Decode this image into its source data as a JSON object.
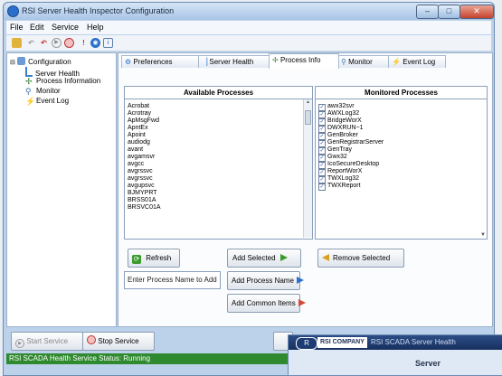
{
  "window": {
    "title": "RSI Server Health Inspector Configuration",
    "controls": {
      "minimize": "–",
      "maximize": "□",
      "close": "✕"
    }
  },
  "menu": [
    "File",
    "Edit",
    "Service",
    "Help"
  ],
  "toolbar_icons": [
    "run-icon",
    "undo-icon",
    "back-icon",
    "play-icon",
    "stop-icon",
    "info-icon",
    "service-icon",
    "about-icon"
  ],
  "tree": {
    "root": "Configuration",
    "children": [
      "Server Health",
      "Process Information",
      "Monitor",
      "Event Log"
    ]
  },
  "tabs": [
    "Preferences",
    "Server Health",
    "Process Info",
    "Monitor",
    "Event Log"
  ],
  "active_tab": "Process Info",
  "available": {
    "header": "Available Processes",
    "items": [
      "Acrobat",
      "Acrotray",
      "ApMsgFwd",
      "ApntEx",
      "Apoint",
      "audiodg",
      "avant",
      "avgamsvr",
      "avgcc",
      "avgrssvc",
      "avgrssvc",
      "avgupsvc",
      "BJMYPRT",
      "BRSS01A",
      "BRSVC01A"
    ]
  },
  "monitored": {
    "header": "Monitored Processes",
    "items": [
      "awx32svr",
      "AWXLog32",
      "BridgeWorX",
      "DWXRUN~1",
      "GenBroker",
      "GenRegistrarServer",
      "GenTray",
      "Gwx32",
      "IcoSecureDesktop",
      "ReportWorX",
      "TWXLog32",
      "TWXReport"
    ]
  },
  "buttons": {
    "refresh": "Refresh",
    "add_selected": "Add Selected",
    "remove_selected": "Remove Selected",
    "add_process_name": "Add Process Name",
    "add_common_items": "Add Common Items",
    "start_service": "Start Service",
    "stop_service": "Stop Service"
  },
  "process_input": {
    "value": "Enter Process Name to Add"
  },
  "status": "RSI SCADA Health Service Status: Running",
  "overlap_window": {
    "logo": "R",
    "company": "RSI COMPANY",
    "title": "RSI SCADA Server Health",
    "subtitle": "Server"
  },
  "colors": {
    "status_bg": "#2f8a2f",
    "accent": "#2a6fc9",
    "add_arrow": "#3a9a2a",
    "add_arrow_blue": "#2d6fd1",
    "remove_arrow": "#d9a020"
  }
}
